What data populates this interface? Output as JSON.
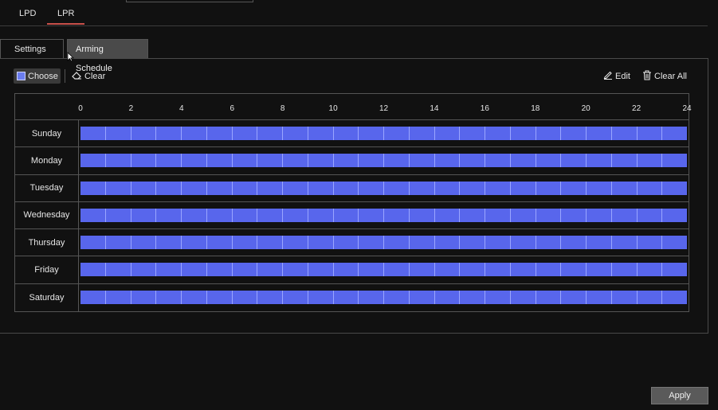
{
  "main_tabs": [
    {
      "label": "LPD",
      "active": false
    },
    {
      "label": "LPR",
      "active": true
    }
  ],
  "sub_tabs": [
    {
      "label": "Settings",
      "active": false
    },
    {
      "label": "Arming Schedule",
      "active": true
    }
  ],
  "toolbar": {
    "choose_label": "Choose",
    "clear_label": "Clear",
    "edit_label": "Edit",
    "clear_all_label": "Clear All"
  },
  "schedule": {
    "hour_labels": [
      "0",
      "2",
      "4",
      "6",
      "8",
      "10",
      "12",
      "14",
      "16",
      "18",
      "20",
      "22",
      "24"
    ],
    "days": [
      "Sunday",
      "Monday",
      "Tuesday",
      "Wednesday",
      "Thursday",
      "Friday",
      "Saturday"
    ],
    "slots_per_day": 24,
    "armed_color": "#5866ec"
  },
  "apply_label": "Apply",
  "colors": {
    "accent": "#c8504a",
    "slot": "#5866ec"
  }
}
